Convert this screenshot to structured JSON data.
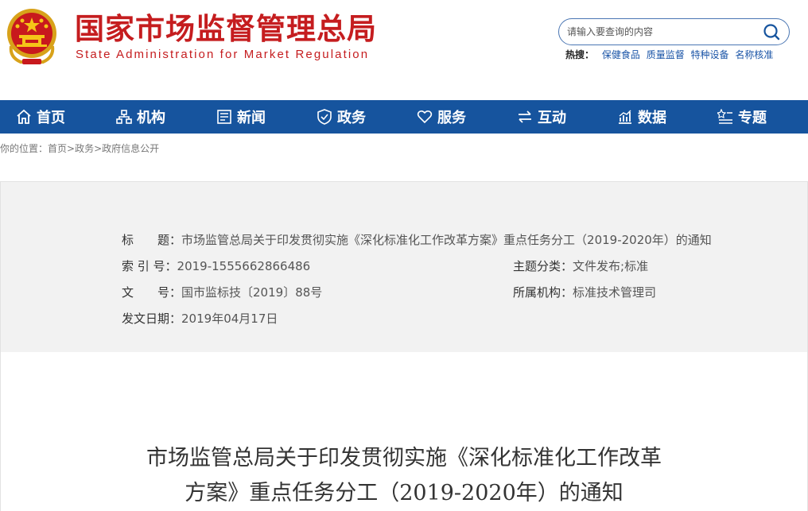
{
  "header": {
    "title_cn": "国家市场监督管理总局",
    "title_en": "State Administration for Market Regulation"
  },
  "search": {
    "placeholder": "请输入要查询的内容",
    "hot_label": "热搜：",
    "hot_terms": [
      "保健食品",
      "质量监督",
      "特种设备",
      "名称核准"
    ]
  },
  "nav": {
    "items": [
      {
        "label": "首页",
        "icon": "home-icon"
      },
      {
        "label": "机构",
        "icon": "org-chart-icon"
      },
      {
        "label": "新闻",
        "icon": "newspaper-icon"
      },
      {
        "label": "政务",
        "icon": "shield-icon"
      },
      {
        "label": "服务",
        "icon": "heart-icon"
      },
      {
        "label": "互动",
        "icon": "exchange-arrows-icon"
      },
      {
        "label": "数据",
        "icon": "chart-icon"
      },
      {
        "label": "专题",
        "icon": "topics-icon"
      }
    ]
  },
  "breadcrumb": {
    "prefix": "你的位置：",
    "items": [
      "首页",
      "政务",
      "政府信息公开"
    ],
    "separator": ">"
  },
  "info": {
    "title_label": "标　　题：",
    "title_value": "市场监管总局关于印发贯彻实施《深化标准化工作改革方案》重点任务分工（2019-2020年）的通知",
    "index_label": "索 引 号：",
    "index_value": "2019-1555662866486",
    "category_label": "主题分类：",
    "category_value": "文件发布;标准",
    "docno_label": "文　　号：",
    "docno_value": "国市监标技〔2019〕88号",
    "org_label": "所属机构：",
    "org_value": "标准技术管理司",
    "date_label": "发文日期：",
    "date_value": "2019年04月17日"
  },
  "document": {
    "title_line1": "市场监管总局关于印发贯彻实施《深化标准化工作改革",
    "title_line2": "方案》重点任务分工（2019-2020年）的通知"
  },
  "colors": {
    "brand_red": "#c51d1f",
    "nav_blue": "#16549e",
    "link_blue": "#1b55a7",
    "panel_gray": "#f2f2f2"
  }
}
